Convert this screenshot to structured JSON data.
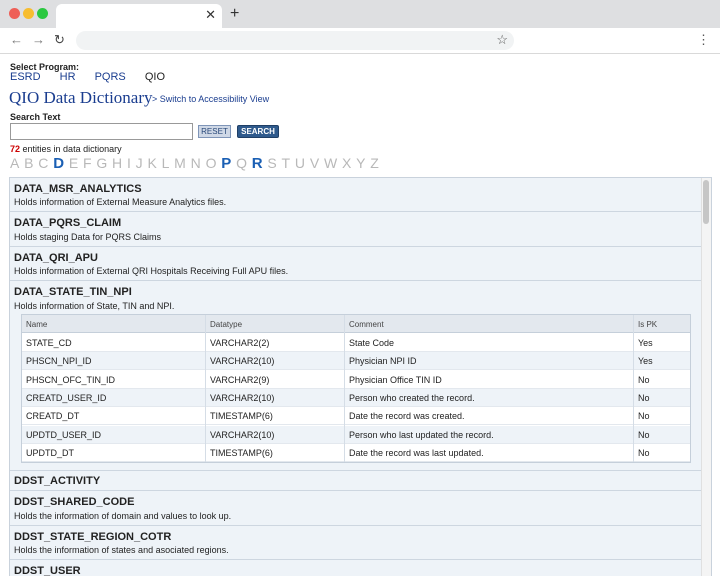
{
  "program": {
    "label": "Select Program:",
    "items": [
      {
        "label": "ESRD",
        "current": false
      },
      {
        "label": "HR",
        "current": false
      },
      {
        "label": "PQRS",
        "current": false
      },
      {
        "label": "QIO",
        "current": true
      }
    ]
  },
  "page_title": "QIO Data Dictionary",
  "accessibility_link": "> Switch to Accessibility View",
  "search": {
    "label": "Search Text",
    "value": "",
    "reset_label": "RESET",
    "search_label": "SEARCH"
  },
  "count": {
    "number": "72",
    "suffix": "entities in data dictionary"
  },
  "alphabet": [
    "A",
    "B",
    "C",
    "D",
    "E",
    "F",
    "G",
    "H",
    "I",
    "J",
    "K",
    "L",
    "M",
    "N",
    "O",
    "P",
    "Q",
    "R",
    "S",
    "T",
    "U",
    "V",
    "W",
    "X",
    "Y",
    "Z"
  ],
  "alphabet_active": [
    "D",
    "P",
    "R"
  ],
  "entities": [
    {
      "name": "DATA_MSR_ANALYTICS",
      "desc": "Holds information of External Measure Analytics files."
    },
    {
      "name": "DATA_PQRS_CLAIM",
      "desc": "Holds staging Data for PQRS Claims"
    },
    {
      "name": "DATA_QRI_APU",
      "desc": "Holds information of External QRI Hospitals Receiving Full APU files."
    },
    {
      "name": "DATA_STATE_TIN_NPI",
      "desc": "Holds information of State, TIN and NPI."
    },
    {
      "name": "DDST_ACTIVITY",
      "desc": ""
    },
    {
      "name": "DDST_SHARED_CODE",
      "desc": "Holds the information of domain and values to look up."
    },
    {
      "name": "DDST_STATE_REGION_COTR",
      "desc": "Holds the information of states and asociated regions."
    },
    {
      "name": "DDST_USER",
      "desc": ""
    }
  ],
  "columns_table": {
    "headers": [
      "Name",
      "Datatype",
      "Comment",
      "Is PK"
    ],
    "rows": [
      [
        "STATE_CD",
        "VARCHAR2(2)",
        "State Code",
        "Yes"
      ],
      [
        "PHSCN_NPI_ID",
        "VARCHAR2(10)",
        "Physician NPI ID",
        "Yes"
      ],
      [
        "PHSCN_OFC_TIN_ID",
        "VARCHAR2(9)",
        "Physician Office TIN ID",
        "No"
      ],
      [
        "CREATD_USER_ID",
        "VARCHAR2(10)",
        "Person who created the record.",
        "No"
      ],
      [
        "CREATD_DT",
        "TIMESTAMP(6)",
        "Date the record was created.",
        "No"
      ],
      [
        "UPDTD_USER_ID",
        "VARCHAR2(10)",
        "Person who last updated the record.",
        "No"
      ],
      [
        "UPDTD_DT",
        "TIMESTAMP(6)",
        "Date the record was last updated.",
        "No"
      ]
    ]
  },
  "colors": {
    "link": "#1a3d8f",
    "count_number": "#cc0000",
    "alpha_active": "#1a5fb4",
    "alpha_inactive": "#b8b8b8",
    "list_bg": "#eef3f8"
  }
}
